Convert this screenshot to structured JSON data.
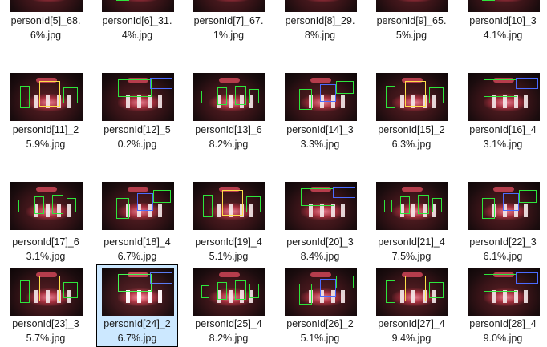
{
  "files": [
    {
      "line1": "personId[5]_68.",
      "line2": "6%.jpg",
      "selected": false
    },
    {
      "line1": "personId[6]_31.",
      "line2": "4%.jpg",
      "selected": false
    },
    {
      "line1": "personId[7]_67.",
      "line2": "1%.jpg",
      "selected": false
    },
    {
      "line1": "personId[8]_29.",
      "line2": "8%.jpg",
      "selected": false
    },
    {
      "line1": "personId[9]_65.",
      "line2": "5%.jpg",
      "selected": false
    },
    {
      "line1": "personId[10]_3",
      "line2": "4.1%.jpg",
      "selected": false
    },
    {
      "line1": "personId[11]_2",
      "line2": "5.9%.jpg",
      "selected": false
    },
    {
      "line1": "personId[12]_5",
      "line2": "0.2%.jpg",
      "selected": false
    },
    {
      "line1": "personId[13]_6",
      "line2": "8.2%.jpg",
      "selected": false
    },
    {
      "line1": "personId[14]_3",
      "line2": "3.3%.jpg",
      "selected": false
    },
    {
      "line1": "personId[15]_2",
      "line2": "6.3%.jpg",
      "selected": false
    },
    {
      "line1": "personId[16]_4",
      "line2": "3.1%.jpg",
      "selected": false
    },
    {
      "line1": "personId[17]_6",
      "line2": "3.1%.jpg",
      "selected": false
    },
    {
      "line1": "personId[18]_4",
      "line2": "6.7%.jpg",
      "selected": false
    },
    {
      "line1": "personId[19]_4",
      "line2": "5.1%.jpg",
      "selected": false
    },
    {
      "line1": "personId[20]_3",
      "line2": "8.4%.jpg",
      "selected": false
    },
    {
      "line1": "personId[21]_4",
      "line2": "7.5%.jpg",
      "selected": false
    },
    {
      "line1": "personId[22]_3",
      "line2": "6.1%.jpg",
      "selected": false
    },
    {
      "line1": "personId[23]_3",
      "line2": "5.7%.jpg",
      "selected": false
    },
    {
      "line1": "personId[24]_2",
      "line2": "6.7%.jpg",
      "selected": true
    },
    {
      "line1": "personId[25]_4",
      "line2": "8.2%.jpg",
      "selected": false
    },
    {
      "line1": "personId[26]_2",
      "line2": "5.1%.jpg",
      "selected": false
    },
    {
      "line1": "personId[27]_4",
      "line2": "9.4%.jpg",
      "selected": false
    },
    {
      "line1": "personId[28]_4",
      "line2": "9.0%.jpg",
      "selected": false
    }
  ]
}
